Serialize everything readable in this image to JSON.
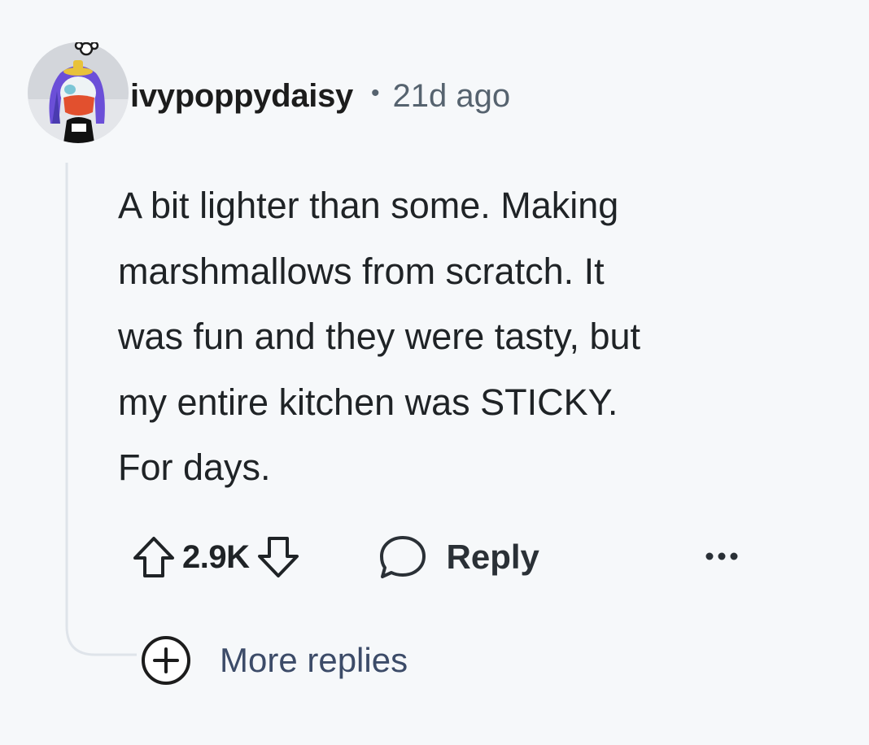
{
  "comment": {
    "username": "ivypoppydaisy",
    "separator": "•",
    "timestamp": "21d ago",
    "avatar_icon": "user-avatar",
    "body_lines": [
      "A bit lighter than some. Making",
      "marshmallows from scratch. It",
      "was fun and they were tasty, but",
      "my entire kitchen was STICKY.",
      "For days."
    ]
  },
  "actions": {
    "upvote_icon": "arrow-up-icon",
    "vote_count": "2.9K",
    "downvote_icon": "arrow-down-icon",
    "reply_icon": "speech-bubble-icon",
    "reply_label": "Reply",
    "more_icon": "ellipsis-icon"
  },
  "thread": {
    "more_replies_icon": "plus-circle-icon",
    "more_replies_label": "More replies"
  },
  "colors": {
    "background": "#f6f8fa",
    "text_primary": "#1c1c1c",
    "text_meta": "#56636f",
    "link_muted": "#3c4b68",
    "thread_line": "#dfe4ea"
  }
}
